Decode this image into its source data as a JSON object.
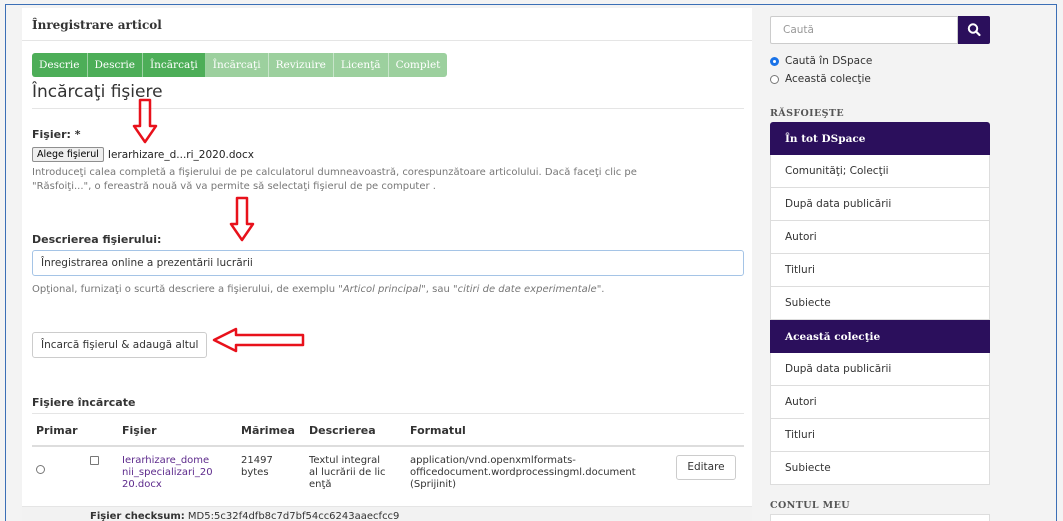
{
  "main": {
    "form_title": "Înregistrare articol",
    "steps": [
      {
        "label": "Descrie",
        "state": "done"
      },
      {
        "label": "Descrie",
        "state": "done"
      },
      {
        "label": "Încărcaţi",
        "state": "done"
      },
      {
        "label": "Încărcaţi",
        "state": "todo"
      },
      {
        "label": "Revizuire",
        "state": "todo"
      },
      {
        "label": "Licenţă",
        "state": "todo"
      },
      {
        "label": "Complet",
        "state": "todo"
      }
    ],
    "page_heading": "Încărcaţi fişiere",
    "file_field": {
      "label": "Fişier: *",
      "button_label": "Alege fişierul",
      "selected_file": "Ierarhizare_d...ri_2020.docx",
      "help_line1": "Introduceţi calea completă a fişierului de pe calculatorul dumneavoastră, corespunzătoare articolului. Dacă faceţi clic pe",
      "help_line2": "\"Răsfoiţi...\", o fereastră nouă vă va permite să selectaţi fişierul de pe computer ."
    },
    "description_field": {
      "label": "Descrierea fişierului:",
      "value": "Înregistrarea online a prezentării lucrării",
      "help_prefix": "Opţional, furnizaţi o scurtă descriere a fişierului, de exemplu \"",
      "help_example1": "Articol principal",
      "help_middle": "\", sau \"",
      "help_example2": "citiri de date experimentale",
      "help_suffix": "\"."
    },
    "upload_button": "Încarcă fişierul & adaugă altul",
    "uploaded": {
      "heading": "Fişiere încărcate",
      "columns": [
        "Primar",
        "Fişier",
        "Mărimea",
        "Descrierea",
        "Formatul"
      ],
      "row": {
        "file_lines": [
          "Ierarhizare_dome",
          "nii_specializari_20",
          "20.docx"
        ],
        "size_lines": [
          "21497",
          "bytes"
        ],
        "desc_lines": [
          "Textul integral",
          "al lucrării de lic",
          "enţă"
        ],
        "format_lines": [
          "application/vnd.openxmlformats-",
          "officedocument.wordprocessingml.document",
          "(Sprijinit)"
        ],
        "edit_label": "Editare"
      },
      "checksum_label": "Fişier checksum:",
      "checksum_value": "MD5:5c32f4dfb8c7d7bf54cc6243aaecfcc9"
    }
  },
  "sidebar": {
    "search_placeholder": "Caută",
    "scope_options": [
      "Caută în DSpace",
      "Această colecţie"
    ],
    "browse_heading": "RĂSFOIEŞTE",
    "all_dspace_heading": "În tot DSpace",
    "all_dspace_items": [
      "Comunităţi; Colecţii",
      "După data publicării",
      "Autori",
      "Titluri",
      "Subiecte"
    ],
    "collection_heading": "Această colecţie",
    "collection_items": [
      "După data publicării",
      "Autori",
      "Titluri",
      "Subiecte"
    ],
    "account_heading": "CONTUL MEU"
  },
  "colors": {
    "step_done": "#4dae58",
    "step_todo": "#9cd09e",
    "sidebar_header": "#2b0f5c",
    "link": "#5d2a8c",
    "annotation_arrow": "#e8111b"
  }
}
